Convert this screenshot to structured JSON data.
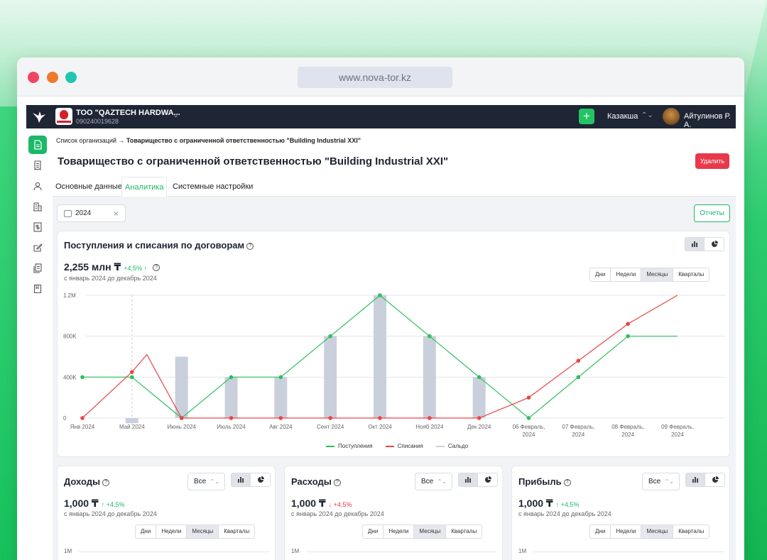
{
  "browser": {
    "url": "www.nova-tor.kz"
  },
  "topbar": {
    "org_name": "ТОО \"QAZTECH HARDWA...",
    "org_bin": "090240019628",
    "city": "Казакша",
    "user_name": "Айтулинов Р. А.",
    "add_label": "+"
  },
  "breadcrumb": {
    "root": "Список организаций →",
    "current": "Товарищество с ограниченной ответственностью \"Building Industrial XXI\""
  },
  "page": {
    "title": "Товарищество с ограниченной ответственностью \"Building Industrial XXI\"",
    "delete_label": "Удалить",
    "tabs": [
      "Основные данные",
      "Аналитика",
      "Системные настройки"
    ],
    "active_tab": "Аналитика",
    "year": "2024",
    "reports_label": "Отчеты"
  },
  "main_card": {
    "title": "Поступления и списания по договорам",
    "value": "2,255 млн ₸",
    "delta": "+4,5% ↑",
    "period": "с январь 2024 до декабрь 2024",
    "periods": [
      "Дни",
      "Недели",
      "Месяцы",
      "Кварталы"
    ],
    "active_period": "Месяцы",
    "legend": [
      "Поступления",
      "Списания",
      "Сальдо"
    ],
    "colors": {
      "income": "#2dbf5a",
      "expense": "#e84545",
      "balance": "#c9d0dc"
    }
  },
  "chart_data": {
    "type": "line",
    "title": "Поступления и списания по договорам",
    "y_ticks": [
      "0",
      "400K",
      "800K",
      "1.2M"
    ],
    "ylim": [
      0,
      1200000
    ],
    "x_ticks": [
      "Янв 2024",
      "Май 2024",
      "Июнь 2024",
      "Июль 2024",
      "Авг 2024",
      "Сент 2024",
      "Окт 2024",
      "Нояб 2024",
      "Дек 2024",
      "06 Февраль, 2024",
      "07 Февраль, 2024",
      "08 Февраль, 2024",
      "09 Февраль, 2024"
    ],
    "series": [
      {
        "name": "Поступления",
        "kind": "line",
        "color": "#2dbf5a",
        "points": [
          [
            0,
            400000
          ],
          [
            1,
            400000
          ],
          [
            2,
            0
          ],
          [
            3,
            400000
          ],
          [
            4,
            400000
          ],
          [
            5,
            800000
          ],
          [
            6,
            1200000
          ],
          [
            7,
            800000
          ],
          [
            8,
            400000
          ],
          [
            9,
            0
          ],
          [
            10,
            400000
          ],
          [
            11,
            800000
          ],
          [
            12,
            800000
          ]
        ]
      },
      {
        "name": "Списания",
        "kind": "line",
        "color": "#e84545",
        "points": [
          [
            0,
            0
          ],
          [
            1,
            450000
          ],
          [
            1.3,
            620000
          ],
          [
            2,
            0
          ],
          [
            3,
            0
          ],
          [
            4,
            0
          ],
          [
            5,
            0
          ],
          [
            6,
            0
          ],
          [
            7,
            0
          ],
          [
            8,
            0
          ],
          [
            9,
            200000
          ],
          [
            10,
            560000
          ],
          [
            11,
            920000
          ],
          [
            12,
            1200000
          ]
        ]
      },
      {
        "name": "Сальдо",
        "kind": "bar",
        "color": "#c9d0dc",
        "points": [
          [
            1,
            -50000
          ],
          [
            2,
            600000
          ],
          [
            3,
            400000
          ],
          [
            4,
            400000
          ],
          [
            5,
            800000
          ],
          [
            6,
            1200000
          ],
          [
            7,
            800000
          ],
          [
            8,
            400000
          ]
        ]
      }
    ]
  },
  "small_cards": [
    {
      "title": "Доходы",
      "value": "1,000 ₸",
      "delta": "↑ +4,5%",
      "direction": "up",
      "period": "с январь 2024 до декабрь 2024",
      "filter": "Все",
      "y_top": "1M"
    },
    {
      "title": "Расходы",
      "value": "1,000 ₸",
      "delta": "↓ +4,5%",
      "direction": "down",
      "period": "с январь 2024 до декабрь 2024",
      "filter": "Все",
      "y_top": "1M"
    },
    {
      "title": "Прибыль",
      "value": "1,000 ₸",
      "delta": "↑ +4,5%",
      "direction": "up",
      "period": "с январь 2024 до декабрь 2024",
      "filter": "Все",
      "y_top": "1M"
    }
  ],
  "icons": {
    "sidebar": [
      "document-icon",
      "receipt-icon",
      "user-icon",
      "building-icon",
      "invoice-icon",
      "edit-icon",
      "copy-icon",
      "book-icon"
    ]
  }
}
